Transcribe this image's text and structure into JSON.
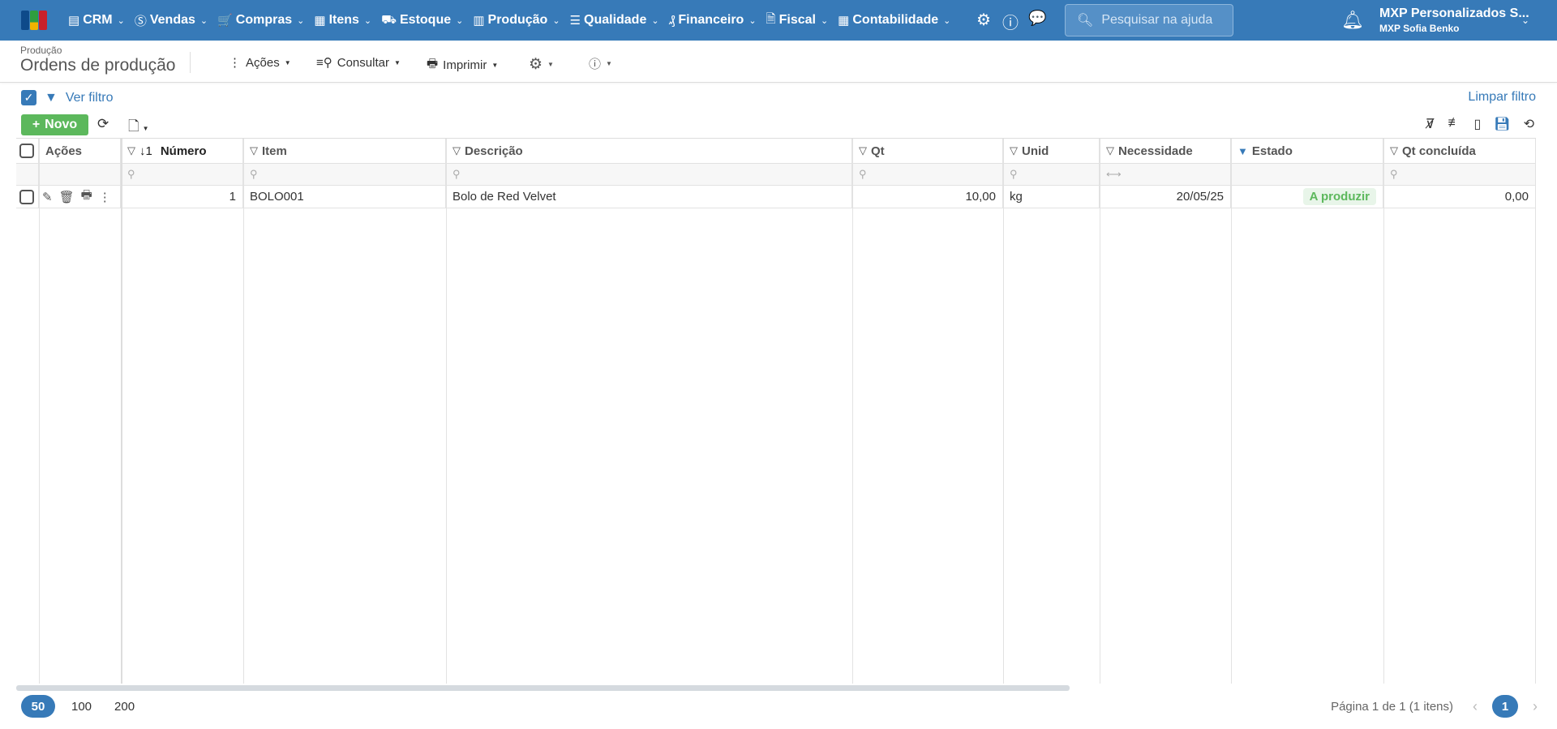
{
  "topbar": {
    "menu": [
      {
        "label": "CRM",
        "icon": "crm-icon",
        "glyph": "▤"
      },
      {
        "label": "Vendas",
        "icon": "dollar-circle-icon",
        "glyph": "Ⓢ"
      },
      {
        "label": "Compras",
        "icon": "cart-icon",
        "glyph": "🛒"
      },
      {
        "label": "Itens",
        "icon": "items-icon",
        "glyph": "▦"
      },
      {
        "label": "Estoque",
        "icon": "stock-icon",
        "glyph": "⛟"
      },
      {
        "label": "Produção",
        "icon": "factory-icon",
        "glyph": "▥"
      },
      {
        "label": "Qualidade",
        "icon": "checklist-icon",
        "glyph": "☰"
      },
      {
        "label": "Financeiro",
        "icon": "money-bag-icon",
        "glyph": "₰"
      },
      {
        "label": "Fiscal",
        "icon": "document-check-icon",
        "glyph": "🗎"
      },
      {
        "label": "Contabilidade",
        "icon": "calculator-icon",
        "glyph": "▦"
      }
    ],
    "search_placeholder": "Pesquisar na ajuda",
    "company": "MXP Personalizados S...",
    "user": "MXP Sofia Benko",
    "colors": {
      "brand": "#377ab8",
      "success": "#5cb85c"
    }
  },
  "header": {
    "breadcrumb": "Produção",
    "title": "Ordens de produção",
    "actions": "Ações",
    "consultar": "Consultar",
    "imprimir": "Imprimir"
  },
  "filter": {
    "ver": "Ver filtro",
    "limpar": "Limpar filtro"
  },
  "toolbar": {
    "novo": "Novo"
  },
  "table": {
    "headers": {
      "acoes": "Ações",
      "sort": "↓1",
      "numero": "Número",
      "item": "Item",
      "descricao": "Descrição",
      "qt": "Qt",
      "unid": "Unid",
      "necessidade": "Necessidade",
      "estado": "Estado",
      "qt_concluida": "Qt concluída"
    },
    "rows": [
      {
        "numero": "1",
        "item": "BOLO001",
        "descricao": "Bolo de Red Velvet",
        "qt": "10,00",
        "unid": "kg",
        "necessidade": "20/05/25",
        "estado": "A produzir",
        "qt_concluida": "0,00"
      }
    ]
  },
  "footer": {
    "sizes": [
      "50",
      "100",
      "200"
    ],
    "page_info": "Página 1 de 1 (1 itens)",
    "current_page": "1"
  }
}
